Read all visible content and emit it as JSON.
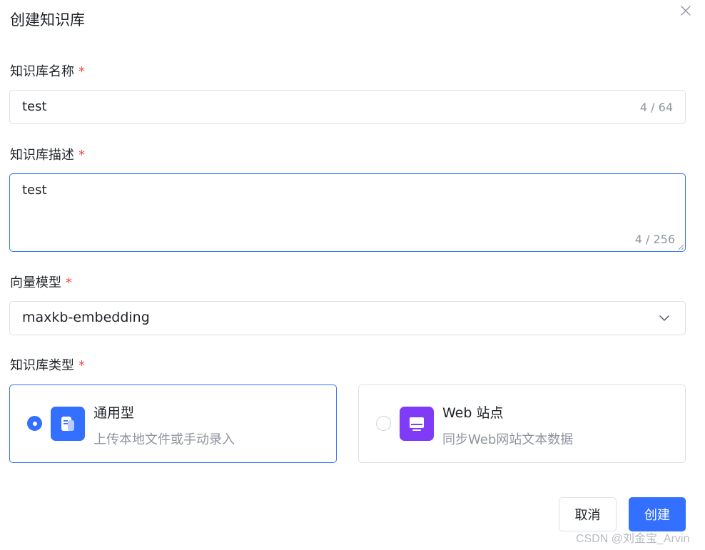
{
  "dialog": {
    "title": "创建知识库",
    "close_icon": "close-icon"
  },
  "form": {
    "required_mark": "*",
    "name": {
      "label": "知识库名称",
      "value": "test",
      "count": "4 / 64"
    },
    "description": {
      "label": "知识库描述",
      "value": "test",
      "count": "4 / 256"
    },
    "model": {
      "label": "向量模型",
      "value": "maxkb-embedding",
      "icon": "chevron-down-icon"
    },
    "type": {
      "label": "知识库类型",
      "options": [
        {
          "title": "通用型",
          "desc": "上传本地文件或手动录入",
          "selected": true,
          "icon": "document-icon",
          "icon_color": "#3370ff"
        },
        {
          "title": "Web 站点",
          "desc": "同步Web网站文本数据",
          "selected": false,
          "icon": "monitor-icon",
          "icon_color": "#7f3bf5"
        }
      ]
    }
  },
  "footer": {
    "cancel_label": "取消",
    "create_label": "创建"
  },
  "watermark": "CSDN @刘金宝_Arvin",
  "colors": {
    "primary": "#3370ff",
    "required": "#f54a45",
    "border": "#dee0e3",
    "muted_text": "#8f959e"
  }
}
